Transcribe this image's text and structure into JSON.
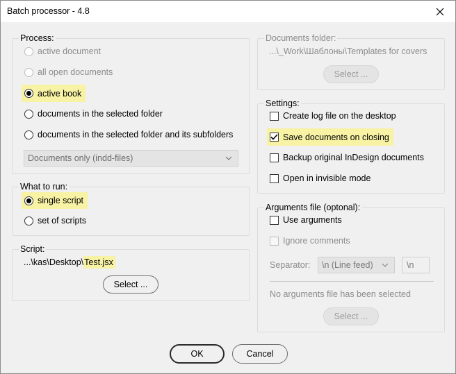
{
  "window": {
    "title": "Batch processor - 4.8"
  },
  "process": {
    "title": "Process:",
    "options": [
      {
        "label": "active document",
        "selected": false,
        "enabled": false
      },
      {
        "label": "all open documents",
        "selected": false,
        "enabled": false
      },
      {
        "label": "active book",
        "selected": true,
        "enabled": true
      },
      {
        "label": "documents in the selected folder",
        "selected": false,
        "enabled": true
      },
      {
        "label": "documents in the selected folder and its subfolders",
        "selected": false,
        "enabled": true
      }
    ],
    "filter_select": {
      "value": "Documents only (indd-files)"
    }
  },
  "what_to_run": {
    "title": "What to run:",
    "options": [
      {
        "label": "single script",
        "selected": true
      },
      {
        "label": "set of scripts",
        "selected": false
      }
    ]
  },
  "script": {
    "title": "Script:",
    "path_prefix": "...\\kas\\Desktop\\",
    "path_file": "Test.jsx",
    "select_label": "Select ..."
  },
  "documents_folder": {
    "title": "Documents folder:",
    "path": "...\\_Work\\Шаблоны\\Templates for covers",
    "select_label": "Select ..."
  },
  "settings": {
    "title": "Settings:",
    "options": [
      {
        "label": "Create log file on the desktop",
        "checked": false
      },
      {
        "label": "Save documents on closing",
        "checked": true
      },
      {
        "label": "Backup original InDesign documents",
        "checked": false
      },
      {
        "label": "Open in invisible mode",
        "checked": false
      }
    ]
  },
  "arguments": {
    "title": "Arguments file (optonal):",
    "use_label": "Use arguments",
    "ignore_label": "Ignore comments",
    "separator_label": "Separator:",
    "separator_value": "\\n (Line feed)",
    "separator_custom": "\\n",
    "status": "No arguments file has been selected",
    "select_label": "Select ..."
  },
  "footer": {
    "ok_label": "OK",
    "cancel_label": "Cancel"
  },
  "colors": {
    "highlight": "#f7f2a4",
    "window_bg": "#f0f0f0",
    "disabled_text": "#8c8c8c"
  }
}
